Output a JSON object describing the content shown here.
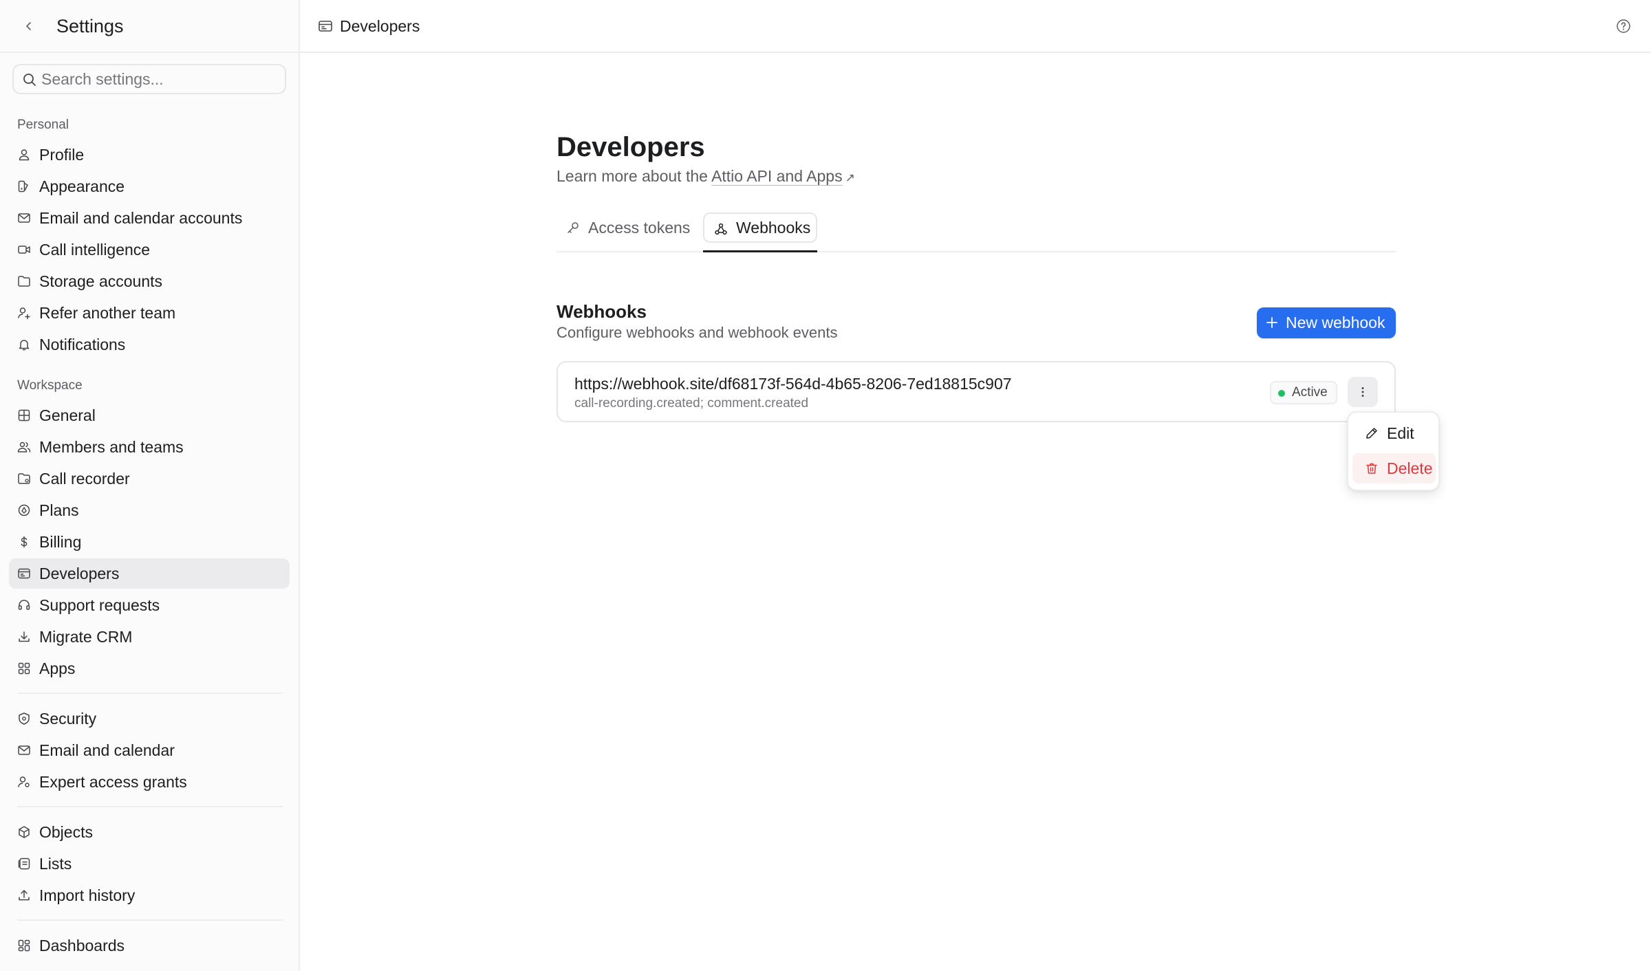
{
  "sidebar": {
    "title": "Settings",
    "search_placeholder": "Search settings...",
    "personal_label": "Personal",
    "personal_items": [
      {
        "label": "Profile",
        "icon": "user-icon"
      },
      {
        "label": "Appearance",
        "icon": "appearance-icon"
      },
      {
        "label": "Email and calendar accounts",
        "icon": "mail-calendar-icon"
      },
      {
        "label": "Call intelligence",
        "icon": "video-icon"
      },
      {
        "label": "Storage accounts",
        "icon": "folder-icon"
      },
      {
        "label": "Refer another team",
        "icon": "refer-user-icon"
      },
      {
        "label": "Notifications",
        "icon": "bell-icon"
      }
    ],
    "workspace_label": "Workspace",
    "workspace_items": [
      {
        "label": "General",
        "icon": "grid-icon"
      },
      {
        "label": "Members and teams",
        "icon": "users-icon"
      },
      {
        "label": "Call recorder",
        "icon": "recorder-icon"
      },
      {
        "label": "Plans",
        "icon": "plans-icon"
      },
      {
        "label": "Billing",
        "icon": "dollar-icon"
      },
      {
        "label": "Developers",
        "icon": "developer-icon",
        "active": true
      },
      {
        "label": "Support requests",
        "icon": "headset-icon"
      },
      {
        "label": "Migrate CRM",
        "icon": "download-icon"
      },
      {
        "label": "Apps",
        "icon": "apps-icon"
      }
    ],
    "security_items": [
      {
        "label": "Security",
        "icon": "shield-icon"
      },
      {
        "label": "Email and calendar",
        "icon": "mail-icon"
      },
      {
        "label": "Expert access grants",
        "icon": "user-key-icon"
      }
    ],
    "data_items": [
      {
        "label": "Objects",
        "icon": "cube-icon"
      },
      {
        "label": "Lists",
        "icon": "list-icon"
      },
      {
        "label": "Import history",
        "icon": "upload-icon"
      }
    ],
    "extra_items": [
      {
        "label": "Dashboards",
        "icon": "dashboard-icon"
      }
    ]
  },
  "topbar": {
    "title": "Developers",
    "icon": "developer-icon",
    "help_icon": "help-icon"
  },
  "main": {
    "title": "Developers",
    "subtitle_prefix": "Learn more about the ",
    "subtitle_link": "Attio API and Apps",
    "subtitle_link_icon": "↗",
    "tabs": [
      {
        "label": "Access tokens",
        "icon": "key-icon",
        "active": false
      },
      {
        "label": "Webhooks",
        "icon": "webhook-icon",
        "active": true
      }
    ],
    "section_title": "Webhooks",
    "section_subtitle": "Configure webhooks and webhook events",
    "new_button_label": "New webhook",
    "webhooks": [
      {
        "url": "https://webhook.site/df68173f-564d-4b65-8206-7ed18815c907",
        "events": "call-recording.created; comment.created",
        "status": "Active",
        "status_color": "#1dbf63"
      }
    ],
    "context_menu": {
      "edit_label": "Edit",
      "delete_label": "Delete",
      "delete_color": "#e0383e"
    }
  },
  "colors": {
    "accent": "#266df0",
    "active_nav_bg": "#ebebed",
    "border": "#ededef"
  }
}
